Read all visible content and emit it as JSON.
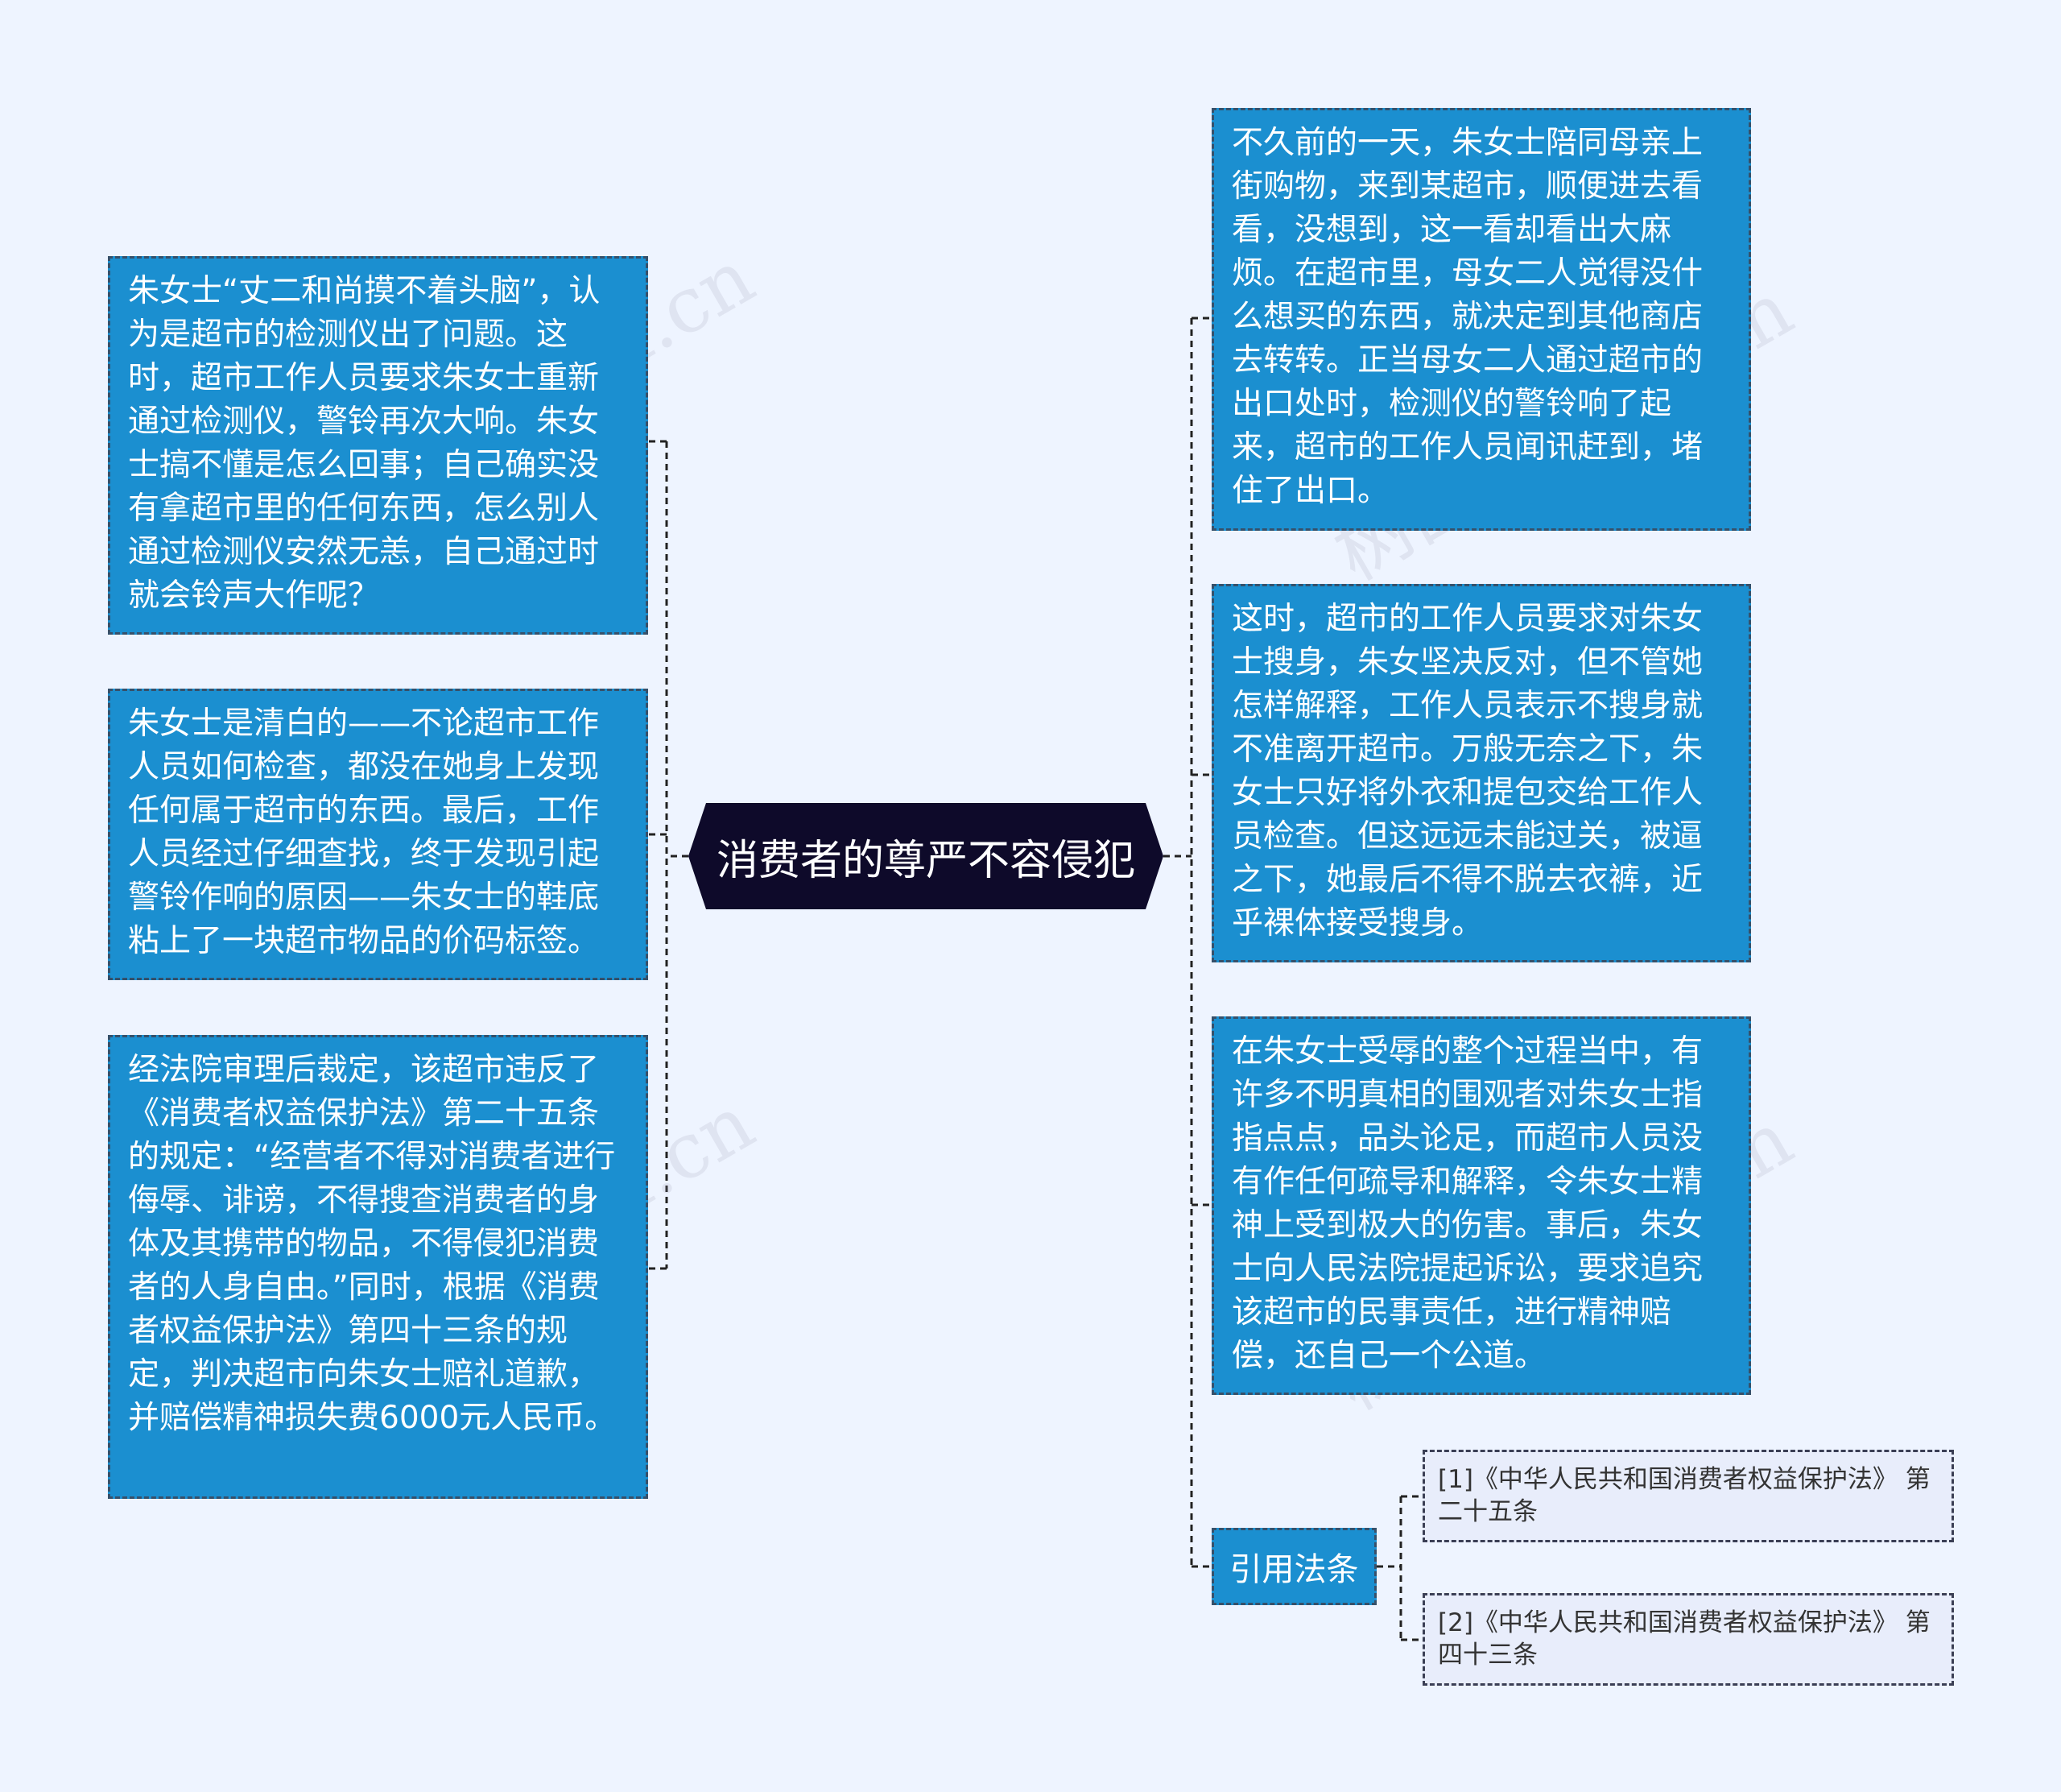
{
  "root": {
    "title": "消费者的尊严不容侵犯"
  },
  "left_nodes": [
    {
      "text": "朱女士“丈二和尚摸不着头脑”，认为是超市的检测仪出了问题。这时，超市工作人员要求朱女士重新通过检测仪，警铃再次大响。朱女士搞不懂是怎么回事；自己确实没有拿超市里的任何东西，怎么别人通过检测仪安然无恙，自己通过时就会铃声大作呢？"
    },
    {
      "text": "朱女士是清白的——不论超市工作人员如何检查，都没在她身上发现任何属于超市的东西。最后，工作人员经过仔细查找，终于发现引起警铃作响的原因——朱女士的鞋底粘上了一块超市物品的价码标签。"
    },
    {
      "text": "经法院审理后裁定，该超市违反了《消费者权益保护法》第二十五条的规定：“经营者不得对消费者进行侮辱、诽谤，不得搜查消费者的身体及其携带的物品，不得侵犯消费者的人身自由。”同时，根据《消费者权益保护法》第四十三条的规定，判决超市向朱女士赔礼道歉，并赔偿精神损失费6000元人民币。"
    }
  ],
  "right_nodes": [
    {
      "text": "不久前的一天，朱女士陪同母亲上街购物，来到某超市，顺便进去看看，没想到，这一看却看出大麻烦。在超市里，母女二人觉得没什么想买的东西，就决定到其他商店去转转。正当母女二人通过超市的出口处时，检测仪的警铃响了起来，超市的工作人员闻讯赶到，堵住了出口。"
    },
    {
      "text": "这时，超市的工作人员要求对朱女士搜身，朱女坚决反对，但不管她怎样解释，工作人员表示不搜身就不准离开超市。万般无奈之下，朱女士只好将外衣和提包交给工作人员检查。但这远远未能过关，被逼之下，她最后不得不脱去衣裤，近乎裸体接受搜身。"
    },
    {
      "text": "在朱女士受辱的整个过程当中，有许多不明真相的围观者对朱女士指指点点，品头论足，而超市人员没有作任何疏导和解释，令朱女士精神上受到极大的伤害。事后，朱女士向人民法院提起诉讼，要求追究该超市的民事责任，进行精神赔偿，还自己一个公道。"
    }
  ],
  "citations": {
    "label": "引用法条",
    "items": [
      {
        "text": "[1]《中华人民共和国消费者权益保护法》 第二十五条"
      },
      {
        "text": "[2]《中华人民共和国消费者权益保护法》 第四十三条"
      }
    ]
  },
  "watermark": "树图 shutu.cn",
  "colors": {
    "background": "#eef4ff",
    "node": "#1b8fd0",
    "root": "#0e0a2a",
    "citation": "#e8edfb",
    "connector": "#222222"
  }
}
